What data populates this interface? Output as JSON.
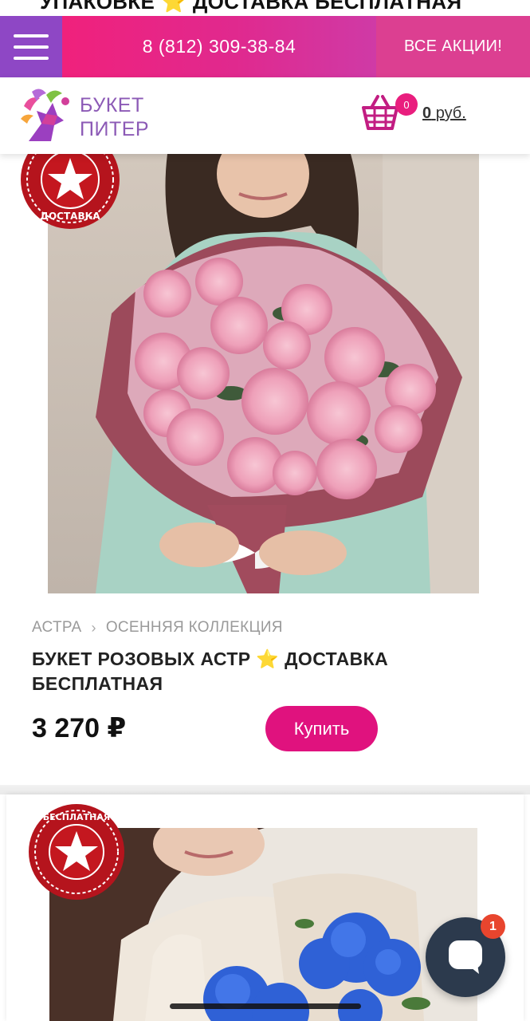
{
  "previous_card": {
    "title_fragment": "УПАКОВКЕ ⭐️ ДОСТАВКА БЕСПЛАТНАЯ"
  },
  "topbar": {
    "menu_icon": "hamburger-icon",
    "phone": "8 (812) 309-38-84",
    "promo_label": "ВСЕ АКЦИИ!",
    "colors": {
      "menu": "#8e47c5",
      "phone": "#e8267f",
      "promo": "#dc3f91"
    }
  },
  "header": {
    "logo": {
      "line1": "БУКЕТ",
      "line2": "ПИТЕР"
    },
    "cart": {
      "icon": "basket-icon",
      "count": "0",
      "sum": "0",
      "currency": "руб."
    }
  },
  "products": [
    {
      "badge_text": "БЕСПЛАТНАЯ ДОСТАВКА",
      "breadcrumbs": [
        "АСТРА",
        "ОСЕННЯЯ КОЛЛЕКЦИЯ"
      ],
      "title": "БУКЕТ РОЗОВЫХ АСТР ⭐️ ДОСТАВКА БЕСПЛАТНАЯ",
      "price": "3 270 ₽",
      "buy_label": "Купить"
    },
    {
      "badge_text": "БЕСПЛАТНАЯ ДОСТАВКА"
    }
  ],
  "chat": {
    "icon": "chat-icon",
    "unread": "1"
  },
  "accent_color": "#e0127e"
}
